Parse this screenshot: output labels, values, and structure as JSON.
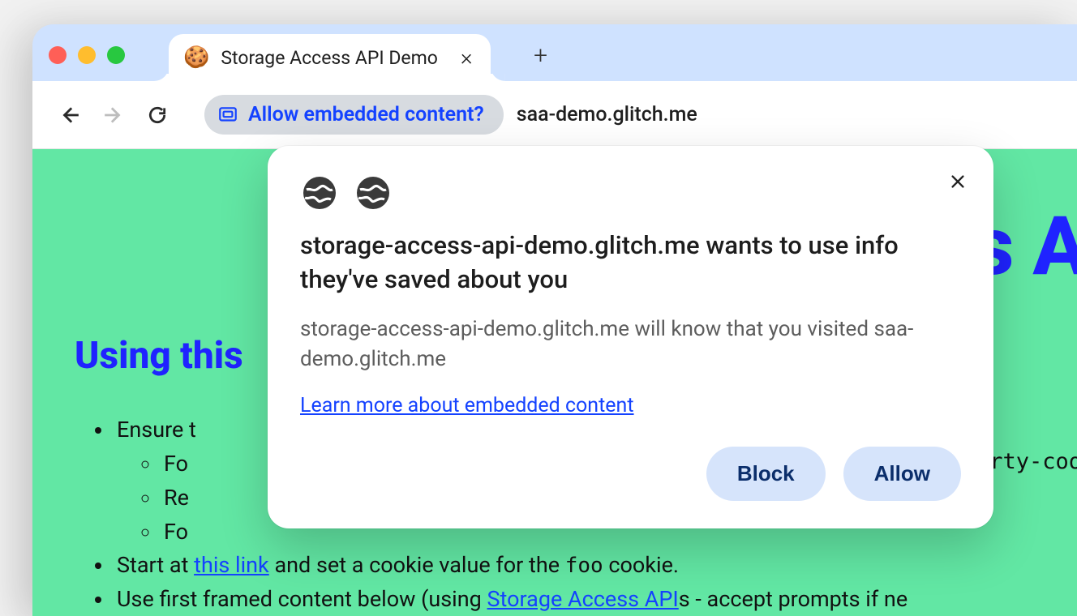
{
  "window": {
    "traffic_lights": {
      "red": "#ff5f57",
      "yellow": "#ffbd2e",
      "green": "#28c840"
    }
  },
  "tab": {
    "favicon": "🍪",
    "title": "Storage Access API Demo"
  },
  "toolbar": {
    "chip_label": "Allow embedded content?",
    "url": "saa-demo.glitch.me"
  },
  "page": {
    "h1_fragment": "ss A",
    "h2": "Using this",
    "list": {
      "ensure": "Ensure t",
      "sub1": "Fo",
      "sub2": "Re",
      "sub3": "Fo",
      "right_fragment": "-party-coo",
      "start_pre": "Start at ",
      "start_link": "this link",
      "start_post": " and set a cookie value for the ",
      "start_code": "foo",
      "start_tail": " cookie.",
      "use_pre": "Use first framed content below (using ",
      "use_link": "Storage Access API",
      "use_post": "s - accept prompts if ne"
    }
  },
  "dialog": {
    "title": "storage-access-api-demo.glitch.me wants to use info they've saved about you",
    "desc": "storage-access-api-demo.glitch.me will know that you visited saa-demo.glitch.me",
    "learn_more": "Learn more about embedded content",
    "block": "Block",
    "allow": "Allow"
  }
}
